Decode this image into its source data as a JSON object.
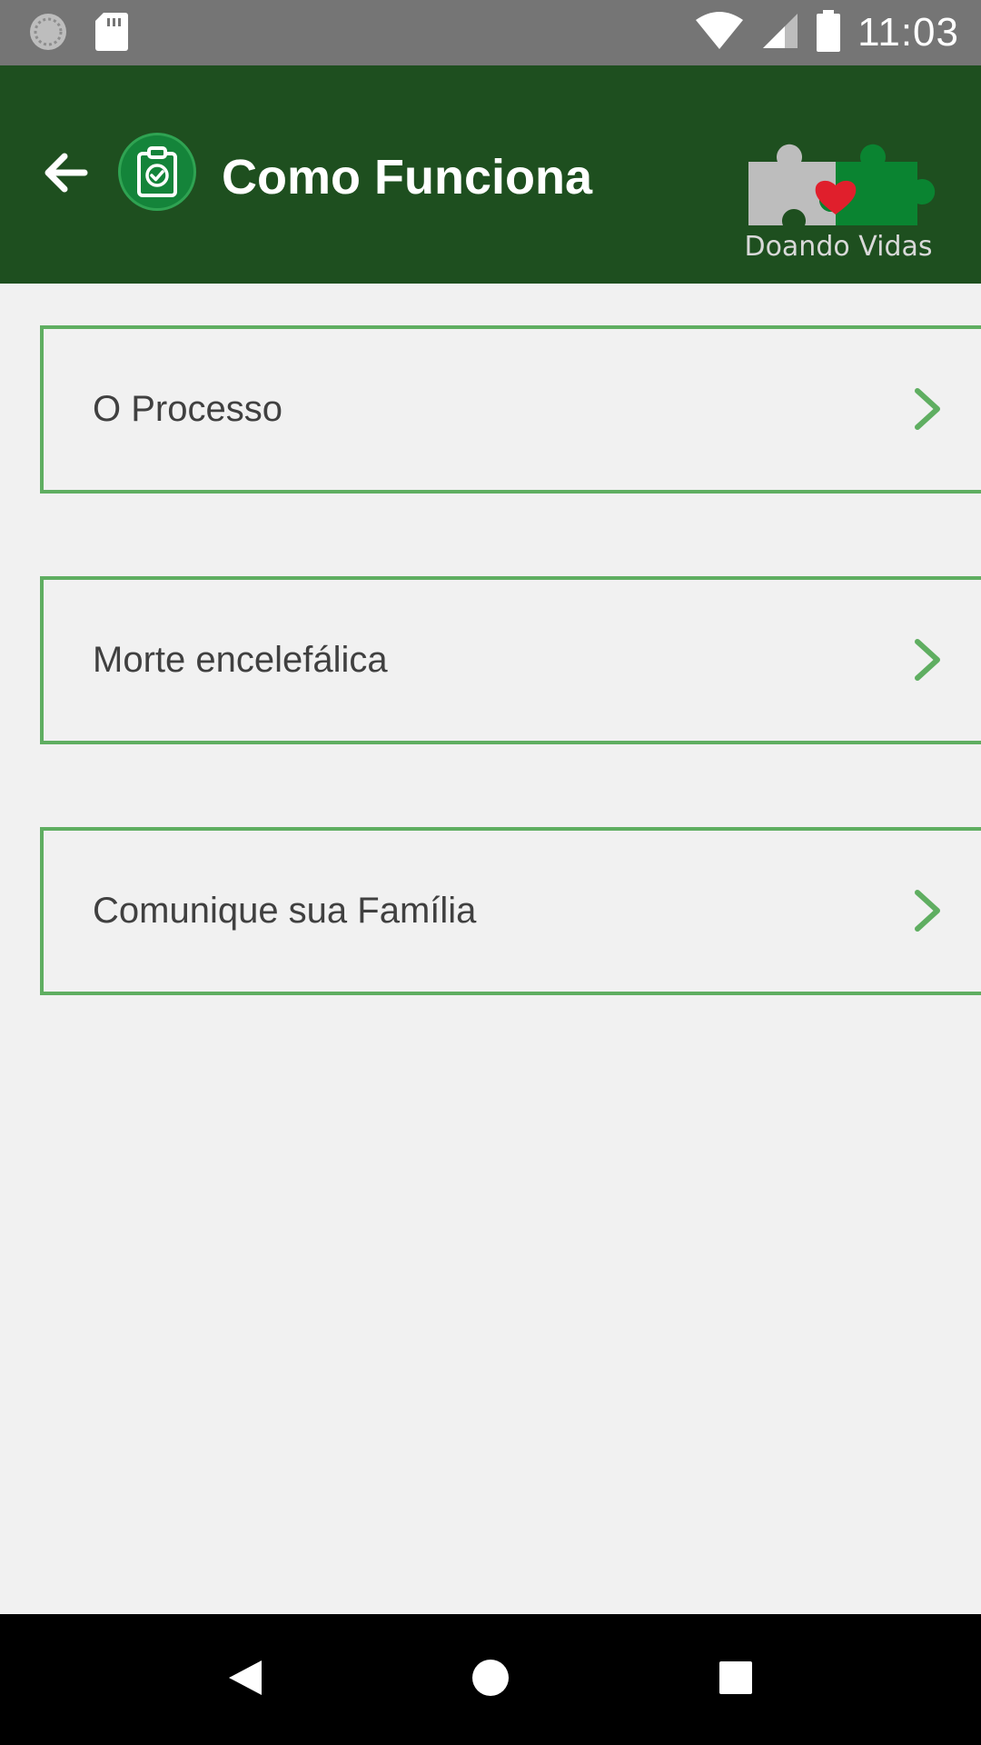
{
  "status_bar": {
    "time": "11:03",
    "icons": [
      "sync-icon",
      "sd-card-icon",
      "wifi-icon",
      "cell-signal-icon",
      "battery-icon"
    ]
  },
  "app_bar": {
    "title": "Como Funciona",
    "back_icon": "arrow-left-icon",
    "title_icon": "clipboard-check-icon",
    "logo_text": "Doando Vidas",
    "colors": {
      "background": "#1e4f1f",
      "icon_circle": "#14843a"
    }
  },
  "menu": {
    "items": [
      {
        "label": "O Processo",
        "icon": "chevron-right-icon"
      },
      {
        "label": "Morte encelefálica",
        "icon": "chevron-right-icon"
      },
      {
        "label": "Comunique sua Família",
        "icon": "chevron-right-icon"
      }
    ],
    "colors": {
      "border": "#5fae61",
      "text": "#404040"
    }
  },
  "nav_bar": {
    "buttons": [
      "back-triangle-icon",
      "home-circle-icon",
      "recents-square-icon"
    ]
  }
}
